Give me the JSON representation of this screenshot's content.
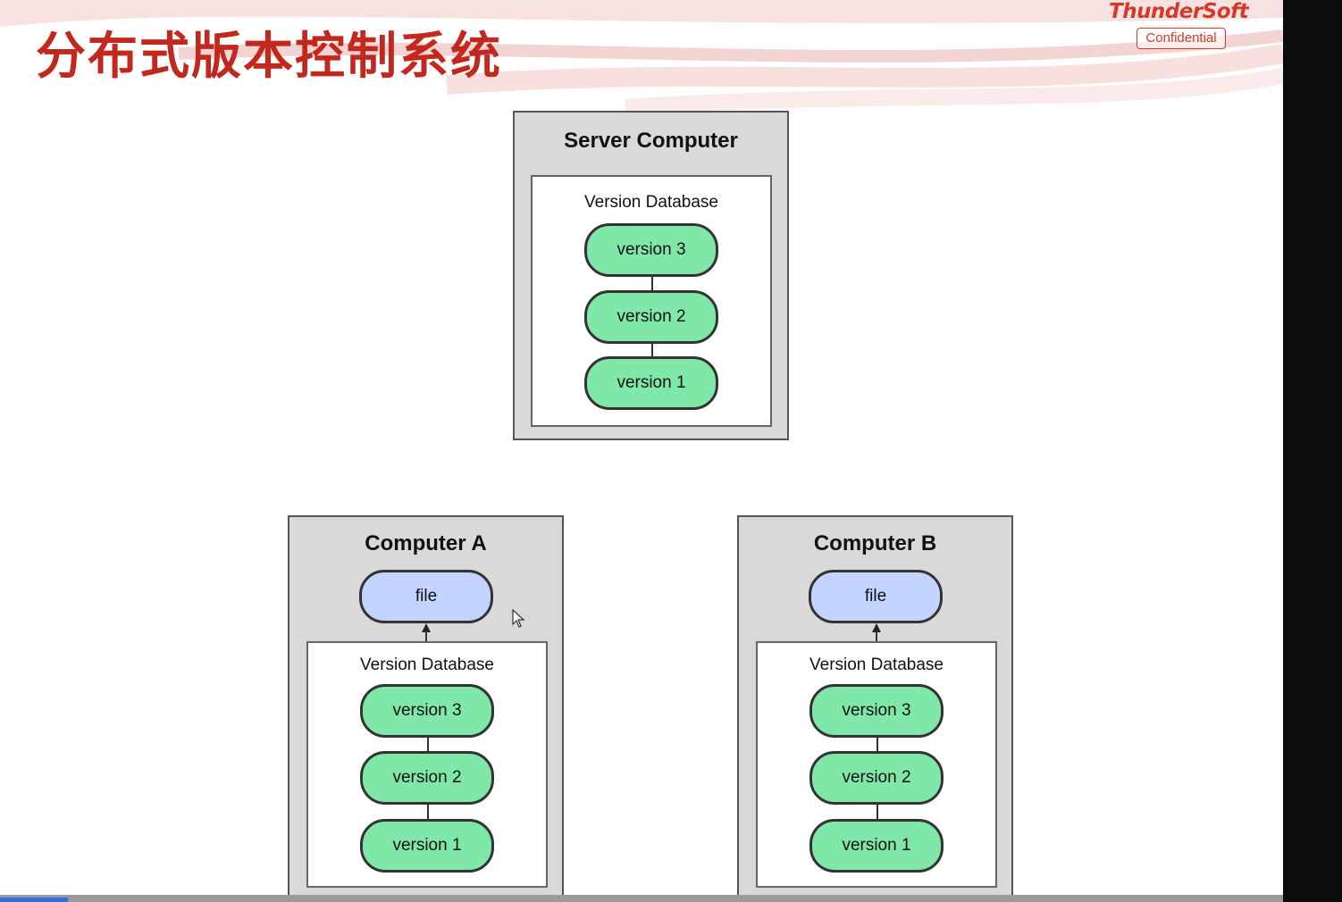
{
  "slide": {
    "title": "分布式版本控制系统",
    "brand": "ThunderSoft",
    "confidential": "Confidential"
  },
  "server": {
    "title": "Server Computer",
    "db_title": "Version Database",
    "versions": [
      "version 3",
      "version 2",
      "version 1"
    ]
  },
  "computer_a": {
    "title": "Computer A",
    "file": "file",
    "db_title": "Version Database",
    "versions": [
      "version 3",
      "version 2",
      "version 1"
    ]
  },
  "computer_b": {
    "title": "Computer B",
    "file": "file",
    "db_title": "Version Database",
    "versions": [
      "version 3",
      "version 2",
      "version 1"
    ]
  },
  "colors": {
    "title_red": "#c3281e",
    "version_green": "#7fe7a8",
    "file_blue": "#c2d4ff",
    "box_gray": "#d9d9d9"
  }
}
